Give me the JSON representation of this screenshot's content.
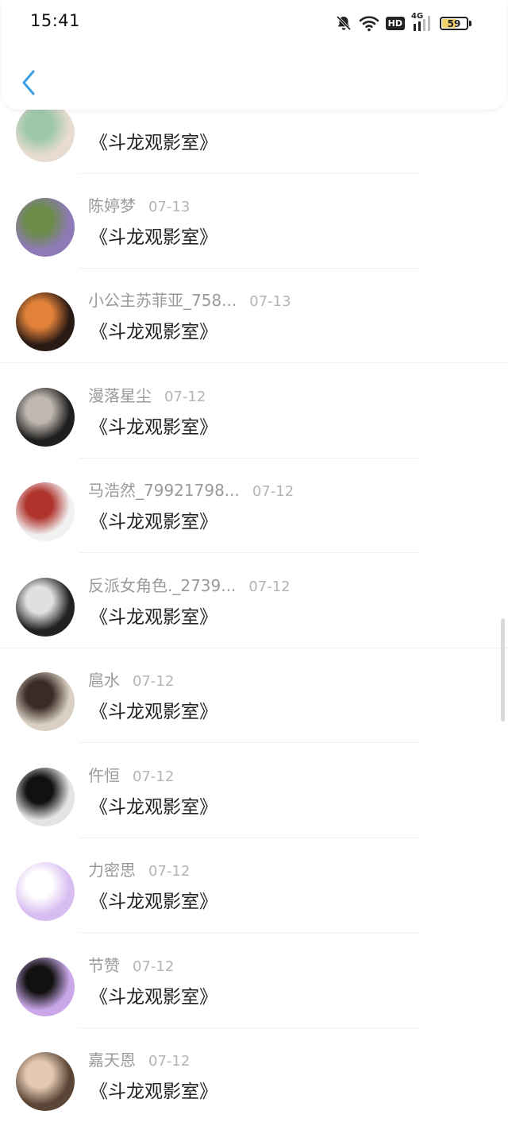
{
  "status_bar": {
    "time": "15:41",
    "network": "4G",
    "hd": "HD",
    "battery_level": "59",
    "battery_fraction": 0.59,
    "icons": [
      "mute-bell-icon",
      "wifi-icon",
      "hd-icon",
      "signal-4g-icon",
      "battery-icon"
    ]
  },
  "header": {
    "back_icon": "chevron-left-icon"
  },
  "messages": [
    {
      "user": "",
      "date": "",
      "text": "《斗龙观影室》",
      "avatar_colors": [
        "#e8dcd0",
        "#9cc7a8"
      ]
    },
    {
      "user": "陈婷梦",
      "date": "07-13",
      "text": "《斗龙观影室》",
      "avatar_colors": [
        "#8e7ab7",
        "#6c8c4a"
      ]
    },
    {
      "user": "小公主苏菲亚_758...",
      "date": "07-13",
      "text": "《斗龙观影室》",
      "avatar_colors": [
        "#2a1a14",
        "#e2823a"
      ]
    },
    {
      "user": "漫落星尘",
      "date": "07-12",
      "text": "《斗龙观影室》",
      "avatar_colors": [
        "#1f1f1f",
        "#bfb7b0"
      ]
    },
    {
      "user": "马浩然_79921798...",
      "date": "07-12",
      "text": "《斗龙观影室》",
      "avatar_colors": [
        "#f1f1f1",
        "#b0332d"
      ]
    },
    {
      "user": "反派女角色._2739...",
      "date": "07-12",
      "text": "《斗龙观影室》",
      "avatar_colors": [
        "#222222",
        "#e0e0e0"
      ]
    },
    {
      "user": "扈水",
      "date": "07-12",
      "text": "《斗龙观影室》",
      "avatar_colors": [
        "#d9cfc4",
        "#3a2c25"
      ]
    },
    {
      "user": "仵恒",
      "date": "07-12",
      "text": "《斗龙观影室》",
      "avatar_colors": [
        "#e4e4e4",
        "#111111"
      ]
    },
    {
      "user": "力密思",
      "date": "07-12",
      "text": "《斗龙观影室》",
      "avatar_colors": [
        "#d8bdf0",
        "#ffffff"
      ]
    },
    {
      "user": "节赞",
      "date": "07-12",
      "text": "《斗龙观影室》",
      "avatar_colors": [
        "#c9a7e8",
        "#111111"
      ]
    },
    {
      "user": "嘉天恩",
      "date": "07-12",
      "text": "《斗龙观影室》",
      "avatar_colors": [
        "#5a4536",
        "#e4c9b2"
      ]
    }
  ]
}
